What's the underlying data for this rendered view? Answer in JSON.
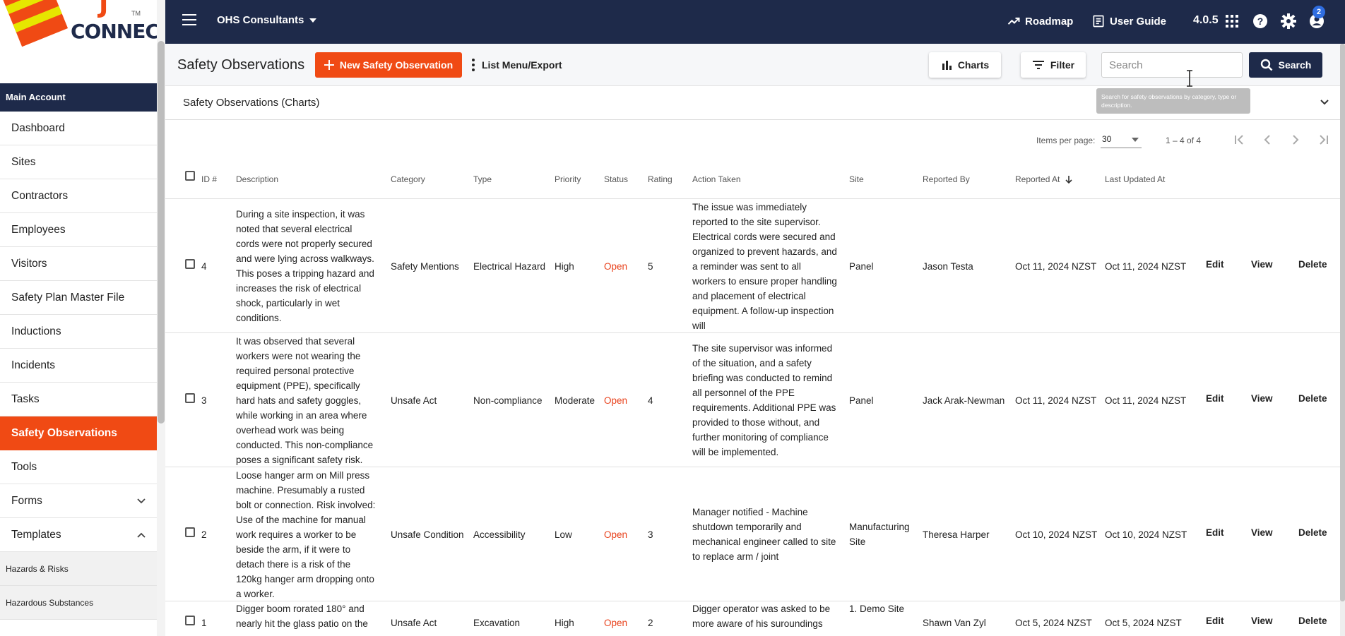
{
  "logo": {
    "top_text": "J",
    "bottom_text": "CONNECT",
    "tm": "TM"
  },
  "sidebar": {
    "account_header": "Main Account",
    "items": [
      {
        "label": "Dashboard"
      },
      {
        "label": "Sites"
      },
      {
        "label": "Contractors"
      },
      {
        "label": "Employees"
      },
      {
        "label": "Visitors"
      },
      {
        "label": "Safety Plan Master File"
      },
      {
        "label": "Inductions"
      },
      {
        "label": "Incidents"
      },
      {
        "label": "Tasks"
      },
      {
        "label": "Safety Observations",
        "active": true
      },
      {
        "label": "Tools"
      },
      {
        "label": "Forms",
        "expand": "chevron-down"
      },
      {
        "label": "Templates",
        "expand": "chevron-up"
      }
    ],
    "sub_items": [
      {
        "label": "Hazards & Risks"
      },
      {
        "label": "Hazardous Substances"
      }
    ]
  },
  "topbar": {
    "org_name": "OHS Consultants",
    "roadmap_label": "Roadmap",
    "guide_label": "User Guide",
    "version": "4.0.5",
    "notifications_count": "2",
    "accent": "#1e2a4a"
  },
  "header": {
    "title": "Safety Observations",
    "new_button_label": "New Safety Observation",
    "list_menu_label": "List Menu/Export",
    "charts_label": "Charts",
    "filter_label": "Filter",
    "search_placeholder": "Search",
    "search_button_label": "Search",
    "search_tooltip": "Search for safety observations by category, type or description.",
    "brand_color": "#f04a14"
  },
  "charts_panel": {
    "title": "Safety Observations (Charts)"
  },
  "paginator": {
    "items_per_page_label": "Items per page:",
    "items_per_page_value": "30",
    "range_label": "1 – 4 of 4"
  },
  "table": {
    "columns": [
      "ID #",
      "Description",
      "Category",
      "Type",
      "Priority",
      "Status",
      "Rating",
      "Action Taken",
      "Site",
      "Reported By",
      "Reported At",
      "Last Updated At"
    ],
    "action_labels": {
      "edit": "Edit",
      "view": "View",
      "delete": "Delete"
    },
    "rows": [
      {
        "id": "4",
        "description": [
          "During a site inspection, it was",
          "noted that several electrical",
          "cords were not properly secured",
          "and were lying across walkways.",
          "This poses a tripping hazard and",
          "increases the risk of electrical",
          "shock, particularly in wet",
          "conditions."
        ],
        "category": "Safety Mentions",
        "type": "Electrical Hazard",
        "priority": "High",
        "status": "Open",
        "rating": "5",
        "action_taken": [
          "The issue was immediately",
          "reported to the site supervisor.",
          "Electrical cords were secured and",
          "organized to prevent hazards, and",
          "a reminder was sent to all",
          "workers to ensure proper handling",
          "and placement of electrical",
          "equipment. A follow-up inspection",
          "will"
        ],
        "site": [
          "Panel"
        ],
        "reported_by": "Jason Testa",
        "reported_at": "Oct 11, 2024 NZST",
        "updated_at": "Oct 11, 2024 NZST"
      },
      {
        "id": "3",
        "description": [
          "It was observed that several",
          "workers were not wearing the",
          "required personal protective",
          "equipment (PPE), specifically",
          "hard hats and safety goggles,",
          "while working in an area where",
          "overhead work was being",
          "conducted. This non-compliance",
          "poses a significant safety risk."
        ],
        "category": "Unsafe Act",
        "type": "Non-compliance",
        "priority": "Moderate",
        "status": "Open",
        "rating": "4",
        "action_taken": [
          "The site supervisor was informed",
          "of the situation, and a safety",
          "briefing was conducted to remind",
          "all personnel of the PPE",
          "requirements. Additional PPE was",
          "provided to those without, and",
          "further monitoring of compliance",
          "will be implemented."
        ],
        "site": [
          "Panel"
        ],
        "reported_by": "Jack Arak-Newman",
        "reported_at": "Oct 11, 2024 NZST",
        "updated_at": "Oct 11, 2024 NZST"
      },
      {
        "id": "2",
        "description": [
          "Loose hanger arm on Mill press",
          "machine. Presumably a rusted",
          "bolt or connection. Risk involved:",
          "Use of the machine for manual",
          "work requires a worker to be",
          "beside the arm, if it were to",
          "detach there is a risk of the",
          "120kg hanger arm dropping onto",
          "a worker."
        ],
        "category": "Unsafe Condition",
        "type": "Accessibility",
        "priority": "Low",
        "status": "Open",
        "rating": "3",
        "action_taken": [
          "Manager notified - Machine",
          "shutdown temporarily and",
          "mechanical engineer called to site",
          "to replace arm / joint"
        ],
        "site": [
          "Manufacturing",
          "Site"
        ],
        "reported_by": "Theresa Harper",
        "reported_at": "Oct 10, 2024 NZST",
        "updated_at": "Oct 10, 2024 NZST"
      },
      {
        "id": "1",
        "description": [
          "Digger boom rorated 180° and",
          "nearly hit the glass patio on the"
        ],
        "category": "Unsafe Act",
        "type": "Excavation",
        "priority": "High",
        "status": "Open",
        "rating": "2",
        "action_taken": [
          "Digger operator was asked to be",
          "more aware of his suroundings"
        ],
        "site": [
          "1. Demo Site"
        ],
        "reported_by": "Shawn Van Zyl",
        "reported_at": "Oct 5, 2024 NZST",
        "updated_at": "Oct 5, 2024 NZST"
      }
    ]
  }
}
